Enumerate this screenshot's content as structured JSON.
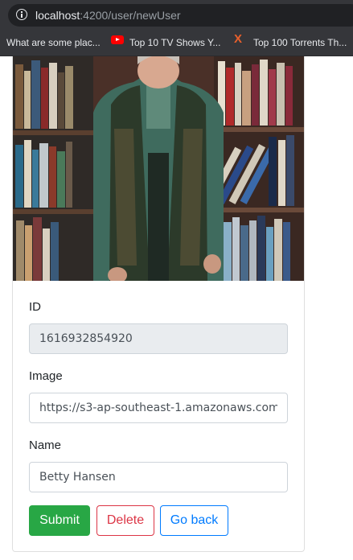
{
  "browser": {
    "url_host": "localhost",
    "url_path": ":4200/user/newUser",
    "bookmarks": [
      {
        "label": "What are some plac...",
        "icon": "none"
      },
      {
        "label": "Top 10 TV Shows Y...",
        "icon": "youtube-icon"
      },
      {
        "label": "Top 100 Torrents Th...",
        "icon": "x-icon"
      }
    ]
  },
  "photo": {
    "alt": "user-photo"
  },
  "form": {
    "id_label": "ID",
    "id_value": "1616932854920",
    "image_label": "Image",
    "image_value": "https://s3-ap-southeast-1.amazonaws.com",
    "name_label": "Name",
    "name_value": "Betty Hansen"
  },
  "buttons": {
    "submit": "Submit",
    "delete": "Delete",
    "back": "Go back"
  },
  "colors": {
    "submit": "#28a745",
    "delete": "#dc3545",
    "back": "#007bff",
    "chrome": "#35363a"
  }
}
